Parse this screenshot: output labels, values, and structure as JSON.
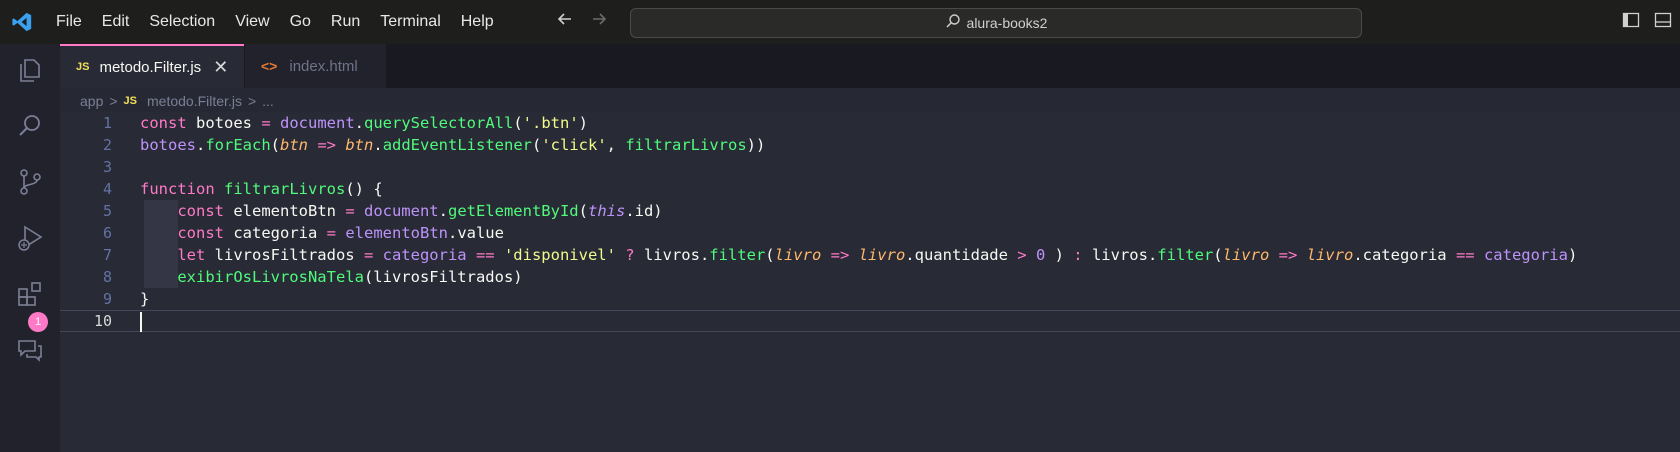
{
  "menu": [
    "File",
    "Edit",
    "Selection",
    "View",
    "Go",
    "Run",
    "Terminal",
    "Help"
  ],
  "command_center": {
    "text": "alura-books2"
  },
  "tabs": [
    {
      "icon": "JS",
      "label": "metodo.Filter.js",
      "close": "✕",
      "active": true
    },
    {
      "icon": "<>",
      "label": "index.html",
      "active": false
    }
  ],
  "breadcrumb": {
    "folder": "app",
    "sep": ">",
    "file_icon": "JS",
    "file": "metodo.Filter.js",
    "rest": "..."
  },
  "activity": {
    "extensions_badge": "1"
  },
  "editor": {
    "current_line": 10,
    "lines": [
      {
        "n": "1",
        "tokens": [
          [
            "k",
            "const "
          ],
          [
            "t",
            "botoes "
          ],
          [
            "k",
            "= "
          ],
          [
            "v",
            "document"
          ],
          [
            "t",
            "."
          ],
          [
            "f",
            "querySelectorAll"
          ],
          [
            "t",
            "("
          ],
          [
            "s",
            "'.btn'"
          ],
          [
            "t",
            ")"
          ]
        ]
      },
      {
        "n": "2",
        "tokens": [
          [
            "v",
            "botoes"
          ],
          [
            "t",
            "."
          ],
          [
            "f",
            "forEach"
          ],
          [
            "t",
            "("
          ],
          [
            "p",
            "btn"
          ],
          [
            "k",
            " => "
          ],
          [
            "p",
            "btn"
          ],
          [
            "t",
            "."
          ],
          [
            "f",
            "addEventListener"
          ],
          [
            "t",
            "("
          ],
          [
            "s",
            "'click'"
          ],
          [
            "t",
            ", "
          ],
          [
            "f",
            "filtrarLivros"
          ],
          [
            "t",
            "))"
          ]
        ]
      },
      {
        "n": "3",
        "tokens": []
      },
      {
        "n": "4",
        "tokens": [
          [
            "k",
            "function "
          ],
          [
            "f",
            "filtrarLivros"
          ],
          [
            "t",
            "() {"
          ]
        ]
      },
      {
        "n": "5",
        "tokens": [
          [
            "t",
            "    "
          ],
          [
            "k",
            "const "
          ],
          [
            "t",
            "elementoBtn "
          ],
          [
            "k",
            "= "
          ],
          [
            "v",
            "document"
          ],
          [
            "t",
            "."
          ],
          [
            "f",
            "getElementById"
          ],
          [
            "t",
            "("
          ],
          [
            "vi",
            "this"
          ],
          [
            "t",
            ".id)"
          ]
        ]
      },
      {
        "n": "6",
        "tokens": [
          [
            "t",
            "    "
          ],
          [
            "k",
            "const "
          ],
          [
            "t",
            "categoria "
          ],
          [
            "k",
            "= "
          ],
          [
            "v",
            "elementoBtn"
          ],
          [
            "t",
            ".value"
          ]
        ]
      },
      {
        "n": "7",
        "tokens": [
          [
            "t",
            "    "
          ],
          [
            "k",
            "let "
          ],
          [
            "t",
            "livrosFiltrados "
          ],
          [
            "k",
            "= "
          ],
          [
            "v",
            "categoria"
          ],
          [
            "k",
            " == "
          ],
          [
            "s",
            "'disponivel'"
          ],
          [
            "k",
            " ? "
          ],
          [
            "t",
            "livros."
          ],
          [
            "f",
            "filter"
          ],
          [
            "t",
            "("
          ],
          [
            "p",
            "livro"
          ],
          [
            "k",
            " => "
          ],
          [
            "p",
            "livro"
          ],
          [
            "t",
            ".quantidade "
          ],
          [
            "k",
            "> "
          ],
          [
            "v",
            "0"
          ],
          [
            "t",
            " ) "
          ],
          [
            "k",
            ": "
          ],
          [
            "t",
            "livros."
          ],
          [
            "f",
            "filter"
          ],
          [
            "t",
            "("
          ],
          [
            "p",
            "livro"
          ],
          [
            "k",
            " => "
          ],
          [
            "p",
            "livro"
          ],
          [
            "t",
            ".categoria "
          ],
          [
            "k",
            "== "
          ],
          [
            "v",
            "categoria"
          ],
          [
            "t",
            ")"
          ]
        ]
      },
      {
        "n": "8",
        "tokens": [
          [
            "t",
            "    "
          ],
          [
            "f",
            "exibirOsLivrosNaTela"
          ],
          [
            "t",
            "(livrosFiltrados)"
          ]
        ]
      },
      {
        "n": "9",
        "tokens": [
          [
            "t",
            "}"
          ]
        ]
      },
      {
        "n": "10",
        "tokens": []
      }
    ]
  },
  "colors": {
    "keyword": "#ff79c6",
    "function": "#50fa7b",
    "string": "#f1fa8c",
    "param": "#ffb86c",
    "variable": "#bd93f9",
    "text": "#f8f8f2",
    "accent": "#ff79c6"
  }
}
